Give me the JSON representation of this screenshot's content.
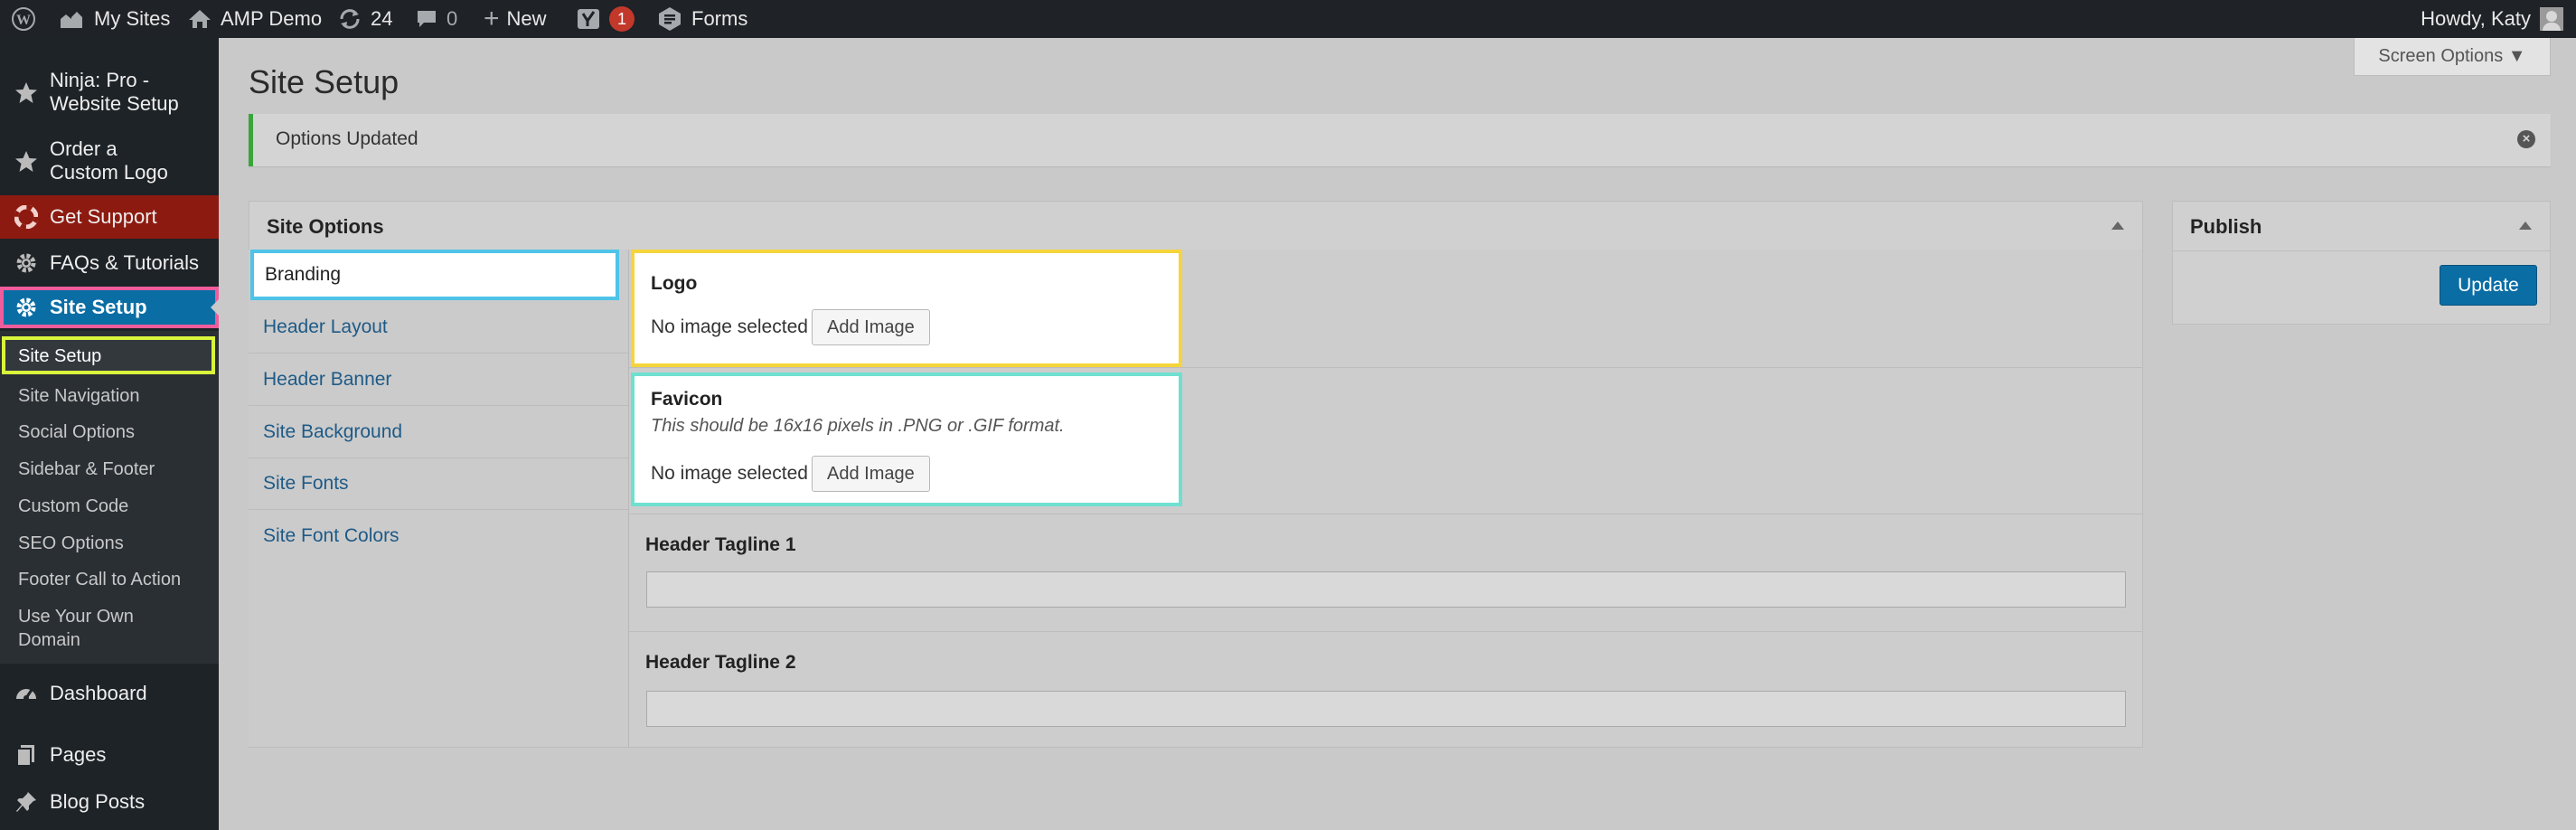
{
  "adminbar": {
    "my_sites": "My Sites",
    "site_name": "AMP Demo",
    "updates_count": "24",
    "comments_count": "0",
    "new_label": "New",
    "yoast_badge": "1",
    "forms_label": "Forms",
    "howdy": "Howdy, Katy"
  },
  "sidebar": {
    "items": [
      {
        "label": "Ninja: Pro - Website Setup",
        "icon": "star-icon"
      },
      {
        "label": "Order a Custom Logo",
        "icon": "star-icon"
      },
      {
        "label": "Get Support",
        "icon": "lifebuoy-icon"
      },
      {
        "label": "FAQs & Tutorials",
        "icon": "gear-icon"
      },
      {
        "label": "Site Setup",
        "icon": "gear-icon"
      }
    ],
    "submenu": [
      "Site Setup",
      "Site Navigation",
      "Social Options",
      "Sidebar & Footer",
      "Custom Code",
      "SEO Options",
      "Footer Call to Action",
      "Use Your Own Domain"
    ],
    "bottom_items": [
      {
        "label": "Dashboard",
        "icon": "dashboard-icon"
      },
      {
        "label": "Pages",
        "icon": "pages-icon"
      },
      {
        "label": "Blog Posts",
        "icon": "pin-icon"
      }
    ]
  },
  "page": {
    "title": "Site Setup",
    "screen_options": "Screen Options ▼",
    "notice": "Options Updated"
  },
  "site_options": {
    "title": "Site Options",
    "tabs": [
      "Branding",
      "Header Layout",
      "Header Banner",
      "Site Background",
      "Site Fonts",
      "Site Font Colors"
    ],
    "logo": {
      "title": "Logo",
      "status": "No image selected",
      "button": "Add Image"
    },
    "favicon": {
      "title": "Favicon",
      "desc": "This should be 16x16 pixels in .PNG or .GIF format.",
      "status": "No image selected",
      "button": "Add Image"
    },
    "tagline1": {
      "title": "Header Tagline 1",
      "value": ""
    },
    "tagline2": {
      "title": "Header Tagline 2",
      "value": ""
    }
  },
  "publish": {
    "title": "Publish",
    "button": "Update"
  },
  "colors": {
    "adminbar": "#1f2226",
    "sidebar": "#1e2327",
    "get_support": "#8d1a10",
    "site_setup_active": "#0a6ea5",
    "pink_highlight": "#f05c9c",
    "lime_highlight": "#d9f53b",
    "cyan_highlight": "#4fc3e8",
    "yellow_highlight": "#f5d53b",
    "teal_highlight": "#6fe0d0",
    "update_button": "#0a6ea5"
  }
}
